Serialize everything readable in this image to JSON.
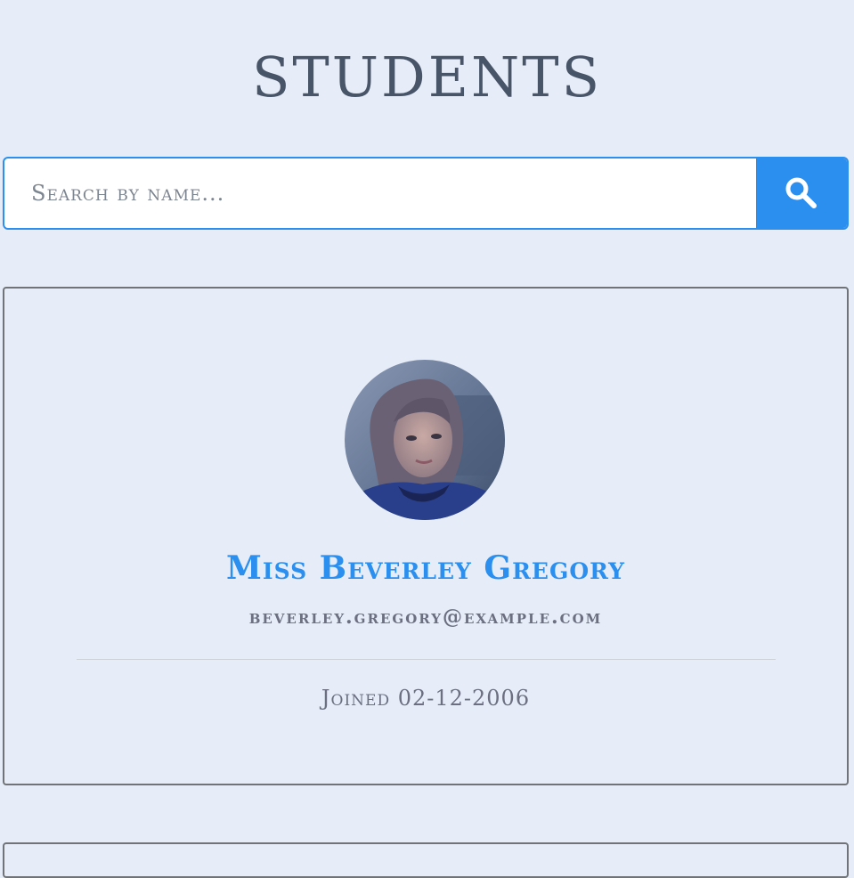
{
  "page": {
    "title": "STUDENTS"
  },
  "search": {
    "placeholder": "Search by name...",
    "button_icon": "search-icon"
  },
  "students": [
    {
      "name": "Miss Beverley Gregory",
      "email": "beverley.gregory@example.com",
      "joined": "Joined 02-12-2006",
      "avatar": "portrait-photo"
    }
  ],
  "colors": {
    "accent": "#2b8fef",
    "background": "#e6edf8",
    "title": "#485468",
    "muted_text": "#6b6f80",
    "card_border": "#707478"
  }
}
